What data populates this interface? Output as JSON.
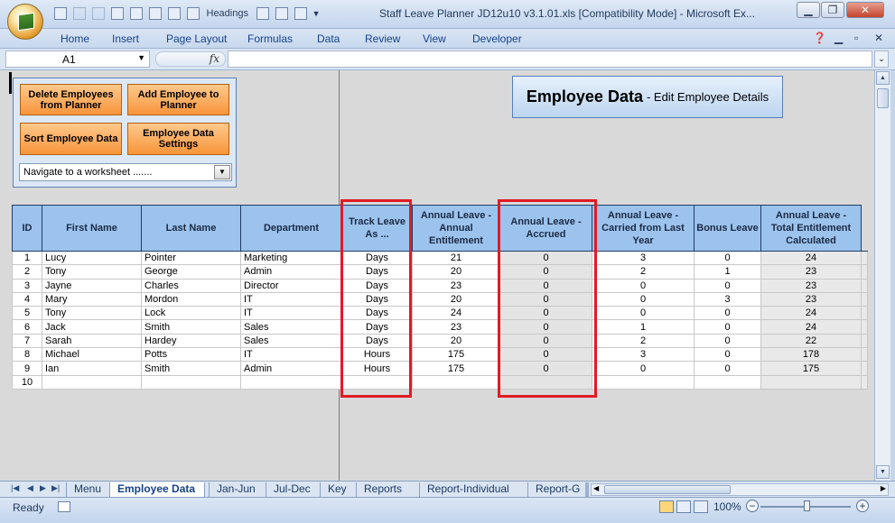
{
  "window": {
    "title": "Staff Leave Planner JD12u10 v3.1.01.xls  [Compatibility Mode] - Microsoft Ex...",
    "qat_headings": "Headings"
  },
  "ribbon": {
    "tabs": [
      "Home",
      "Insert",
      "Page Layout",
      "Formulas",
      "Data",
      "Review",
      "View",
      "Developer"
    ]
  },
  "formula_bar": {
    "name_box": "A1",
    "fx": "fx",
    "value": ""
  },
  "panel": {
    "buttons": {
      "delete": "Delete Employees from Planner",
      "add": "Add Employee to Planner",
      "sort": "Sort  Employee Data",
      "settings": "Employee Data Settings"
    },
    "navigate": "Navigate to a worksheet ......."
  },
  "header_box": {
    "title": "Employee Data",
    "subtitle": "- Edit Employee Details"
  },
  "table": {
    "headers": {
      "id": "ID",
      "first": "First Name",
      "last": "Last Name",
      "dept": "Department",
      "track": "Track Leave As ...",
      "annual": "Annual Leave - Annual Entitlement",
      "accrued": "Annual Leave - Accrued",
      "carried": "Annual Leave - Carried from Last Year",
      "bonus": "Bonus Leave",
      "total": "Annual Leave - Total Entitlement Calculated"
    },
    "rows": [
      {
        "id": "1",
        "first": "Lucy",
        "last": "Pointer",
        "dept": "Marketing",
        "track": "Days",
        "annual": "21",
        "accrued": "0",
        "carried": "3",
        "bonus": "0",
        "total": "24"
      },
      {
        "id": "2",
        "first": "Tony",
        "last": "George",
        "dept": "Admin",
        "track": "Days",
        "annual": "20",
        "accrued": "0",
        "carried": "2",
        "bonus": "1",
        "total": "23"
      },
      {
        "id": "3",
        "first": "Jayne",
        "last": "Charles",
        "dept": "Director",
        "track": "Days",
        "annual": "23",
        "accrued": "0",
        "carried": "0",
        "bonus": "0",
        "total": "23"
      },
      {
        "id": "4",
        "first": "Mary",
        "last": "Mordon",
        "dept": "IT",
        "track": "Days",
        "annual": "20",
        "accrued": "0",
        "carried": "0",
        "bonus": "3",
        "total": "23"
      },
      {
        "id": "5",
        "first": "Tony",
        "last": "Lock",
        "dept": "IT",
        "track": "Days",
        "annual": "24",
        "accrued": "0",
        "carried": "0",
        "bonus": "0",
        "total": "24"
      },
      {
        "id": "6",
        "first": "Jack",
        "last": "Smith",
        "dept": "Sales",
        "track": "Days",
        "annual": "23",
        "accrued": "0",
        "carried": "1",
        "bonus": "0",
        "total": "24"
      },
      {
        "id": "7",
        "first": "Sarah",
        "last": "Hardey",
        "dept": "Sales",
        "track": "Days",
        "annual": "20",
        "accrued": "0",
        "carried": "2",
        "bonus": "0",
        "total": "22"
      },
      {
        "id": "8",
        "first": "Michael",
        "last": "Potts",
        "dept": "IT",
        "track": "Hours",
        "annual": "175",
        "accrued": "0",
        "carried": "3",
        "bonus": "0",
        "total": "178"
      },
      {
        "id": "9",
        "first": "Ian",
        "last": "Smith",
        "dept": "Admin",
        "track": "Hours",
        "annual": "175",
        "accrued": "0",
        "carried": "0",
        "bonus": "0",
        "total": "175"
      },
      {
        "id": "10",
        "first": "",
        "last": "",
        "dept": "",
        "track": "",
        "annual": "",
        "accrued": "",
        "carried": "",
        "bonus": "",
        "total": ""
      }
    ]
  },
  "sheet_tabs": [
    "Menu",
    "Employee Data",
    "Jan-Jun",
    "Jul-Dec",
    "Key",
    "Reports",
    "Report-Individual",
    "Report-G"
  ],
  "active_tab": "Employee Data",
  "status": {
    "ready": "Ready",
    "zoom": "100%"
  },
  "colors": {
    "header_fill": "#9cc3ed",
    "button_orange": "#f7953b",
    "highlight_red": "#e01b24"
  }
}
